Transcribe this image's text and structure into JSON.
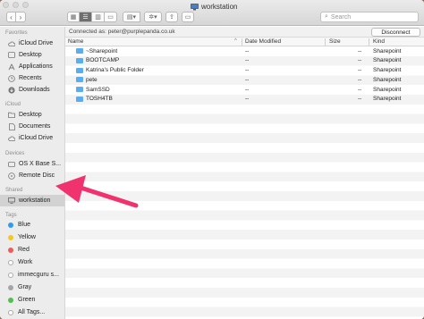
{
  "window": {
    "title": "workstation",
    "search_placeholder": "Search",
    "nav": {
      "back": "‹",
      "forward": "›"
    },
    "view_buttons": [
      "▦",
      "☰",
      "▥",
      "▭",
      "▤▾",
      "✲▾",
      "⇪",
      "▭"
    ],
    "traffic_colors": [
      "#d9d9d9",
      "#d9d9d9",
      "#d9d9d9"
    ]
  },
  "sidebar": {
    "favorites": {
      "heading": "Favorites",
      "items": [
        {
          "label": "iCloud Drive",
          "icon": "cloud-icon"
        },
        {
          "label": "Desktop",
          "icon": "desktop-icon"
        },
        {
          "label": "Applications",
          "icon": "applications-icon"
        },
        {
          "label": "Recents",
          "icon": "clock-icon"
        },
        {
          "label": "Downloads",
          "icon": "download-icon"
        }
      ]
    },
    "icloud": {
      "heading": "iCloud",
      "items": [
        {
          "label": "Desktop",
          "icon": "folder-icon"
        },
        {
          "label": "Documents",
          "icon": "document-icon"
        },
        {
          "label": "iCloud Drive",
          "icon": "cloud-icon"
        }
      ]
    },
    "devices": {
      "heading": "Devices",
      "items": [
        {
          "label": "OS X Base S...",
          "icon": "disk-icon"
        },
        {
          "label": "Remote Disc",
          "icon": "disc-icon"
        }
      ]
    },
    "shared": {
      "heading": "Shared",
      "items": [
        {
          "label": "workstation",
          "icon": "monitor-icon"
        }
      ]
    },
    "tags": {
      "heading": "Tags",
      "items": [
        {
          "label": "Blue",
          "color": "#2f9bf0"
        },
        {
          "label": "Yellow",
          "color": "#f6c625"
        },
        {
          "label": "Red",
          "color": "#f05a55"
        },
        {
          "label": "Work",
          "color": "#ffffff"
        },
        {
          "label": "immecguru s...",
          "color": "#ffffff"
        },
        {
          "label": "Gray",
          "color": "#a5a5a5"
        },
        {
          "label": "Green",
          "color": "#4fc14b"
        },
        {
          "label": "All Tags...",
          "color": "#ffffff"
        }
      ]
    }
  },
  "connection": {
    "label": "Connected as: peter@purplepanda.co.uk",
    "disconnect_label": "Disconnect"
  },
  "table": {
    "columns": [
      "Name",
      "Date Modified",
      "Size",
      "Kind"
    ],
    "rows": [
      {
        "name": "~Sharepoint",
        "date": "--",
        "size": "--",
        "kind": "Sharepoint"
      },
      {
        "name": "BOOTCAMP",
        "date": "--",
        "size": "--",
        "kind": "Sharepoint"
      },
      {
        "name": "Katrina's Public Folder",
        "date": "--",
        "size": "--",
        "kind": "Sharepoint"
      },
      {
        "name": "pete",
        "date": "--",
        "size": "--",
        "kind": "Sharepoint"
      },
      {
        "name": "SamSSD",
        "date": "--",
        "size": "--",
        "kind": "Sharepoint"
      },
      {
        "name": "TOSH4TB",
        "date": "--",
        "size": "--",
        "kind": "Sharepoint"
      }
    ]
  },
  "annotation": {
    "arrow_color": "#f0336e"
  }
}
